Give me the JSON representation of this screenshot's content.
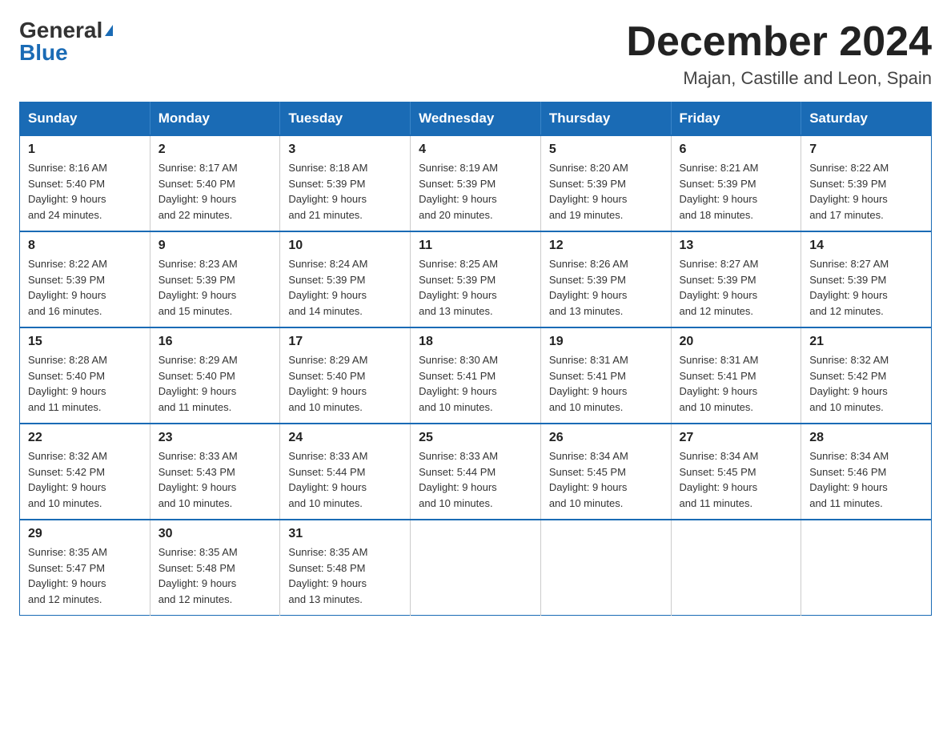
{
  "logo": {
    "general": "General",
    "blue": "Blue"
  },
  "title": "December 2024",
  "location": "Majan, Castille and Leon, Spain",
  "days_of_week": [
    "Sunday",
    "Monday",
    "Tuesday",
    "Wednesday",
    "Thursday",
    "Friday",
    "Saturday"
  ],
  "weeks": [
    [
      {
        "day": "1",
        "sunrise": "8:16 AM",
        "sunset": "5:40 PM",
        "daylight": "9 hours and 24 minutes."
      },
      {
        "day": "2",
        "sunrise": "8:17 AM",
        "sunset": "5:40 PM",
        "daylight": "9 hours and 22 minutes."
      },
      {
        "day": "3",
        "sunrise": "8:18 AM",
        "sunset": "5:39 PM",
        "daylight": "9 hours and 21 minutes."
      },
      {
        "day": "4",
        "sunrise": "8:19 AM",
        "sunset": "5:39 PM",
        "daylight": "9 hours and 20 minutes."
      },
      {
        "day": "5",
        "sunrise": "8:20 AM",
        "sunset": "5:39 PM",
        "daylight": "9 hours and 19 minutes."
      },
      {
        "day": "6",
        "sunrise": "8:21 AM",
        "sunset": "5:39 PM",
        "daylight": "9 hours and 18 minutes."
      },
      {
        "day": "7",
        "sunrise": "8:22 AM",
        "sunset": "5:39 PM",
        "daylight": "9 hours and 17 minutes."
      }
    ],
    [
      {
        "day": "8",
        "sunrise": "8:22 AM",
        "sunset": "5:39 PM",
        "daylight": "9 hours and 16 minutes."
      },
      {
        "day": "9",
        "sunrise": "8:23 AM",
        "sunset": "5:39 PM",
        "daylight": "9 hours and 15 minutes."
      },
      {
        "day": "10",
        "sunrise": "8:24 AM",
        "sunset": "5:39 PM",
        "daylight": "9 hours and 14 minutes."
      },
      {
        "day": "11",
        "sunrise": "8:25 AM",
        "sunset": "5:39 PM",
        "daylight": "9 hours and 13 minutes."
      },
      {
        "day": "12",
        "sunrise": "8:26 AM",
        "sunset": "5:39 PM",
        "daylight": "9 hours and 13 minutes."
      },
      {
        "day": "13",
        "sunrise": "8:27 AM",
        "sunset": "5:39 PM",
        "daylight": "9 hours and 12 minutes."
      },
      {
        "day": "14",
        "sunrise": "8:27 AM",
        "sunset": "5:39 PM",
        "daylight": "9 hours and 12 minutes."
      }
    ],
    [
      {
        "day": "15",
        "sunrise": "8:28 AM",
        "sunset": "5:40 PM",
        "daylight": "9 hours and 11 minutes."
      },
      {
        "day": "16",
        "sunrise": "8:29 AM",
        "sunset": "5:40 PM",
        "daylight": "9 hours and 11 minutes."
      },
      {
        "day": "17",
        "sunrise": "8:29 AM",
        "sunset": "5:40 PM",
        "daylight": "9 hours and 10 minutes."
      },
      {
        "day": "18",
        "sunrise": "8:30 AM",
        "sunset": "5:41 PM",
        "daylight": "9 hours and 10 minutes."
      },
      {
        "day": "19",
        "sunrise": "8:31 AM",
        "sunset": "5:41 PM",
        "daylight": "9 hours and 10 minutes."
      },
      {
        "day": "20",
        "sunrise": "8:31 AM",
        "sunset": "5:41 PM",
        "daylight": "9 hours and 10 minutes."
      },
      {
        "day": "21",
        "sunrise": "8:32 AM",
        "sunset": "5:42 PM",
        "daylight": "9 hours and 10 minutes."
      }
    ],
    [
      {
        "day": "22",
        "sunrise": "8:32 AM",
        "sunset": "5:42 PM",
        "daylight": "9 hours and 10 minutes."
      },
      {
        "day": "23",
        "sunrise": "8:33 AM",
        "sunset": "5:43 PM",
        "daylight": "9 hours and 10 minutes."
      },
      {
        "day": "24",
        "sunrise": "8:33 AM",
        "sunset": "5:44 PM",
        "daylight": "9 hours and 10 minutes."
      },
      {
        "day": "25",
        "sunrise": "8:33 AM",
        "sunset": "5:44 PM",
        "daylight": "9 hours and 10 minutes."
      },
      {
        "day": "26",
        "sunrise": "8:34 AM",
        "sunset": "5:45 PM",
        "daylight": "9 hours and 10 minutes."
      },
      {
        "day": "27",
        "sunrise": "8:34 AM",
        "sunset": "5:45 PM",
        "daylight": "9 hours and 11 minutes."
      },
      {
        "day": "28",
        "sunrise": "8:34 AM",
        "sunset": "5:46 PM",
        "daylight": "9 hours and 11 minutes."
      }
    ],
    [
      {
        "day": "29",
        "sunrise": "8:35 AM",
        "sunset": "5:47 PM",
        "daylight": "9 hours and 12 minutes."
      },
      {
        "day": "30",
        "sunrise": "8:35 AM",
        "sunset": "5:48 PM",
        "daylight": "9 hours and 12 minutes."
      },
      {
        "day": "31",
        "sunrise": "8:35 AM",
        "sunset": "5:48 PM",
        "daylight": "9 hours and 13 minutes."
      },
      null,
      null,
      null,
      null
    ]
  ],
  "labels": {
    "sunrise": "Sunrise:",
    "sunset": "Sunset:",
    "daylight": "Daylight:"
  }
}
